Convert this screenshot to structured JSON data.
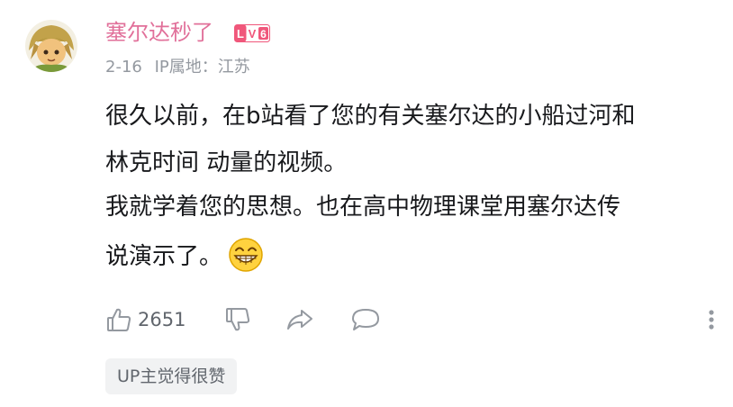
{
  "comment": {
    "username": "塞尔达秒了",
    "level_badge": "LV6",
    "date": "2-16",
    "ip_location": "IP属地：江苏",
    "lines": [
      "很久以前，在b站看了您的有关塞尔达的小船过河和",
      "林克时间 动量的视频。",
      "我就学着您的思想。也在高中物理课堂用塞尔达传",
      "说演示了。"
    ],
    "like_count": "2651",
    "up_tag": "UP主觉得很赞"
  },
  "colors": {
    "username": "#e1709a",
    "badge": "#f0577b",
    "meta_text": "#9499a0",
    "body_text": "#18191c",
    "icon": "#9499a0",
    "tag_bg": "#f1f2f3"
  },
  "icons": [
    "avatar",
    "level-badge",
    "grin-emoji",
    "thumbs-up-icon",
    "thumbs-down-icon",
    "share-icon",
    "reply-icon",
    "more-vertical-icon"
  ]
}
